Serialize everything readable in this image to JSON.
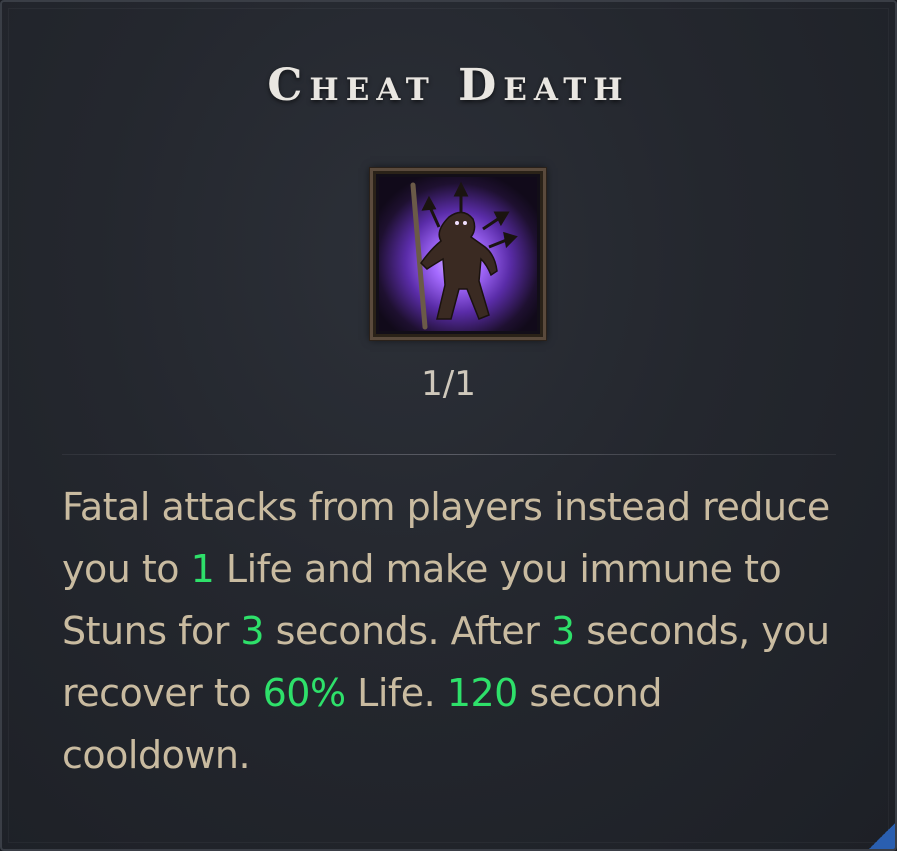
{
  "skill": {
    "title": "Cheat Death",
    "rank": "1/1",
    "icon": "hooded-figure-with-arrows-icon",
    "description": {
      "t1": "Fatal attacks from players instead reduce you to ",
      "n1": "1",
      "t2": " Life and make you immune to Stuns for ",
      "n2": "3",
      "t3": " seconds. After ",
      "n3": "3",
      "t4": " seconds, you recover to ",
      "n4": "60%",
      "t5": " Life. ",
      "n5": "120",
      "t6": " second cooldown."
    }
  },
  "colors": {
    "value_highlight": "#2ee06a",
    "body_text": "#c9bba0",
    "title_text": "#e9e6e1",
    "icon_glow": "#9b5cff"
  }
}
